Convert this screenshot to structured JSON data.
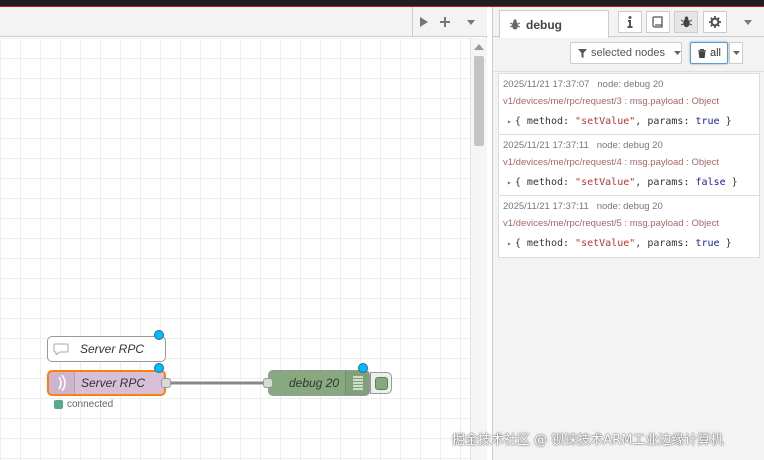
{
  "workspace": {
    "nodes": {
      "inject": {
        "label": "Server RPC"
      },
      "rpc_in": {
        "label": "Server RPC",
        "status": "connected"
      },
      "debug": {
        "label": "debug 20"
      }
    }
  },
  "sidebar": {
    "tab_label": "debug",
    "filter_label": "selected nodes",
    "clear_label": "all",
    "messages": [
      {
        "timestamp": "2025/11/21 17:37:07",
        "node": "node: debug 20",
        "topic": "v1/devices/me/rpc/request/3 : msg.payload : Object",
        "key1": "method",
        "val1": "\"setValue\"",
        "key2": "params",
        "val2": "true"
      },
      {
        "timestamp": "2025/11/21 17:37:11",
        "node": "node: debug 20",
        "topic": "v1/devices/me/rpc/request/4 : msg.payload : Object",
        "key1": "method",
        "val1": "\"setValue\"",
        "key2": "params",
        "val2": "false"
      },
      {
        "timestamp": "2025/11/21 17:37:11",
        "node": "node: debug 20",
        "topic": "v1/devices/me/rpc/request/5 : msg.payload : Object",
        "key1": "method",
        "val1": "\"setValue\"",
        "key2": "params",
        "val2": "true"
      }
    ]
  },
  "watermark": "掘金技术社区 @ 钡铼技术ARM工业边缘计算机",
  "icons": [
    "play-icon",
    "plus-icon",
    "caret-down-icon",
    "bug-icon",
    "info-icon",
    "book-icon",
    "gear-icon",
    "filter-icon",
    "trash-icon",
    "comment-icon",
    "wave-icon",
    "list-icon"
  ],
  "colors": {
    "inject_node": "#ffffff",
    "rpc_node": "#d8bfd8",
    "rpc_selected_border": "#ff7f0e",
    "debug_node": "#87a980",
    "changed_dot": "#00bcff",
    "status_connected": "#55aa88"
  }
}
